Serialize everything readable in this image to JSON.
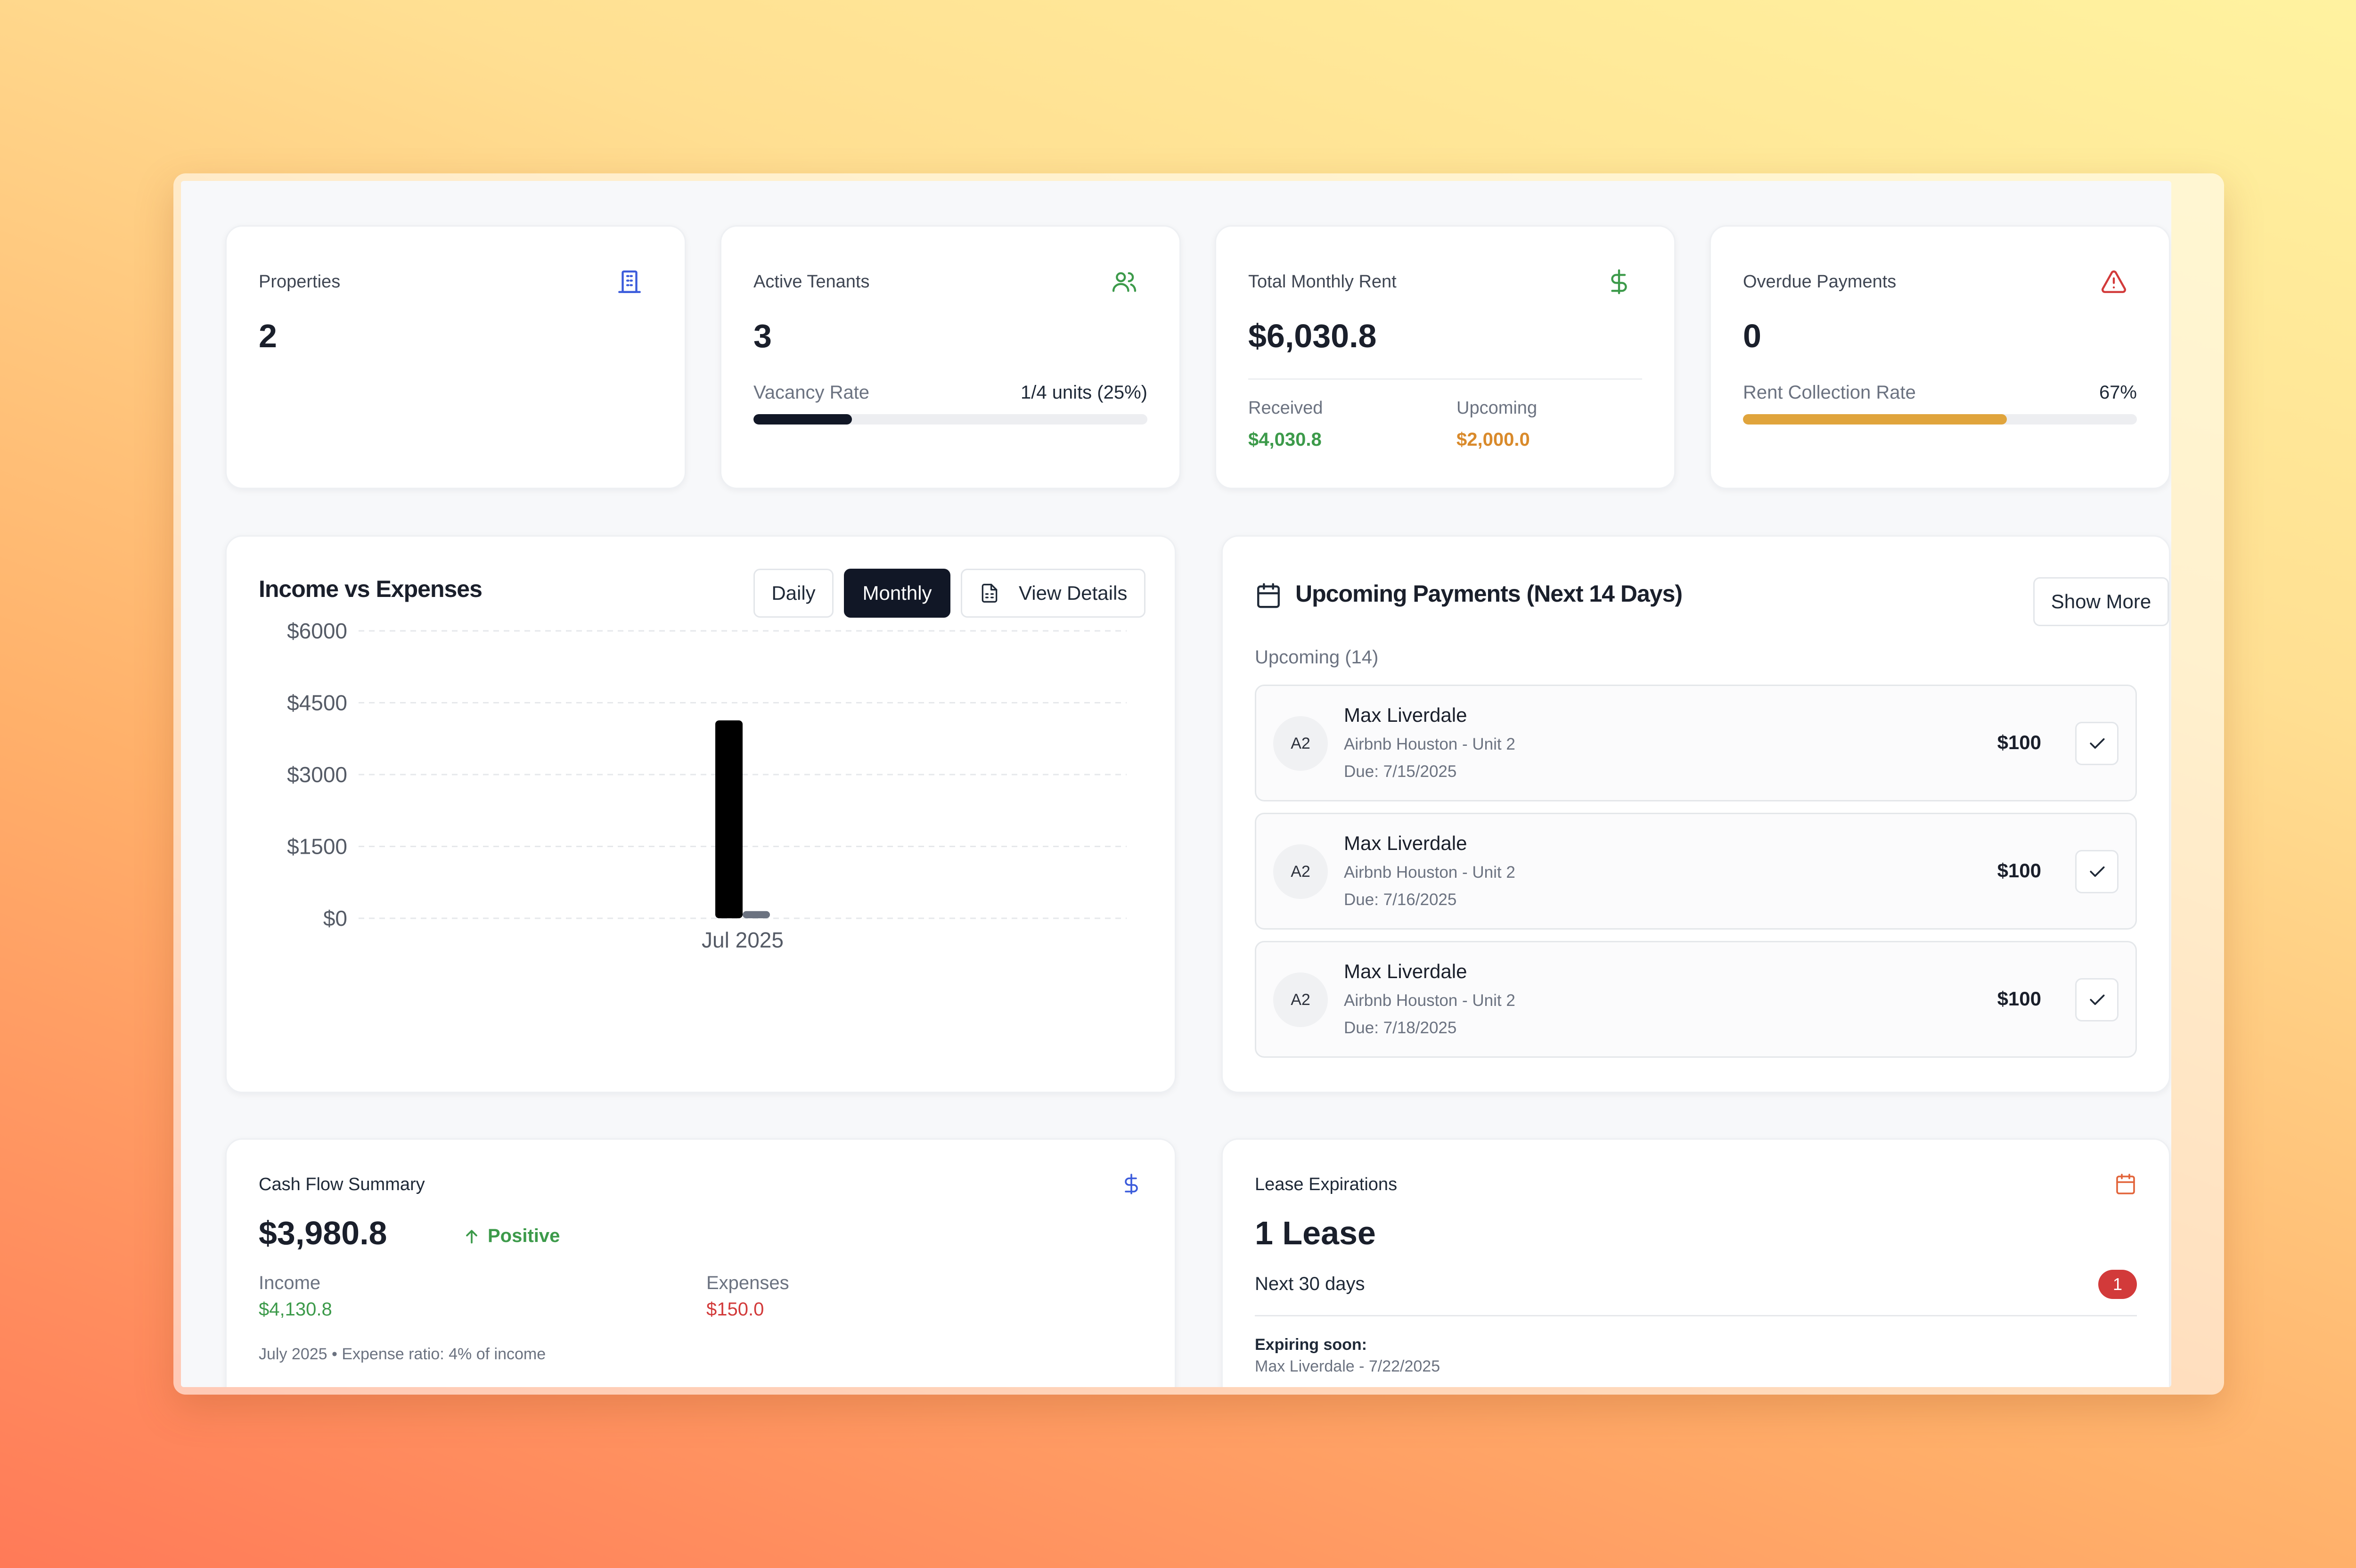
{
  "stats": {
    "properties": {
      "label": "Properties",
      "value": "2",
      "icon": "building-icon"
    },
    "tenants": {
      "label": "Active Tenants",
      "value": "3",
      "icon": "users-icon",
      "vacancy_label": "Vacancy Rate",
      "vacancy_value": "1/4 units (25%)",
      "vacancy_fraction": 0.25
    },
    "rent": {
      "label": "Total Monthly Rent",
      "value": "$6,030.8",
      "icon": "dollar-icon",
      "received_label": "Received",
      "received_value": "$4,030.8",
      "upcoming_label": "Upcoming",
      "upcoming_value": "$2,000.0"
    },
    "overdue": {
      "label": "Overdue Payments",
      "value": "0",
      "icon": "alert-triangle-icon",
      "collection_label": "Rent Collection Rate",
      "collection_value": "67%",
      "collection_fraction": 0.67
    }
  },
  "income_chart": {
    "title": "Income vs Expenses",
    "daily_label": "Daily",
    "monthly_label": "Monthly",
    "details_label": "View Details"
  },
  "chart_data": {
    "type": "bar",
    "categories": [
      "Jul 2025"
    ],
    "series": [
      {
        "values": [
          4130.8
        ],
        "color": "#000000"
      },
      {
        "values": [
          150.0
        ],
        "color": "#6b7280"
      }
    ],
    "y_ticks": [
      "$6000",
      "$4500",
      "$3000",
      "$1500",
      "$0"
    ],
    "y_tick_values": [
      6000,
      4500,
      3000,
      1500,
      0
    ],
    "ylim": [
      0,
      6000
    ],
    "grid": true
  },
  "upcoming": {
    "title": "Upcoming Payments (Next 14 Days)",
    "show_more_label": "Show More",
    "section_label": "Upcoming (14)",
    "items": [
      {
        "initials": "A2",
        "name": "Max Liverdale",
        "property": "Airbnb Houston - Unit 2",
        "due": "Due: 7/15/2025",
        "amount": "$100"
      },
      {
        "initials": "A2",
        "name": "Max Liverdale",
        "property": "Airbnb Houston - Unit 2",
        "due": "Due: 7/16/2025",
        "amount": "$100"
      },
      {
        "initials": "A2",
        "name": "Max Liverdale",
        "property": "Airbnb Houston - Unit 2",
        "due": "Due: 7/18/2025",
        "amount": "$100"
      }
    ]
  },
  "cashflow": {
    "label": "Cash Flow Summary",
    "value": "$3,980.8",
    "trend_label": "Positive",
    "income_label": "Income",
    "income_value": "$4,130.8",
    "expenses_label": "Expenses",
    "expenses_value": "$150.0",
    "footer": "July 2025 • Expense ratio: 4% of income"
  },
  "lease": {
    "label": "Lease Expirations",
    "value": "1 Lease",
    "period_label": "Next 30 days",
    "badge": "1",
    "expiring_label": "Expiring soon:",
    "expiring_detail": "Max Liverdale - 7/22/2025"
  },
  "colors": {
    "accent_dark": "#111726",
    "positive": "#3c9a4a",
    "warning": "#d98a2b",
    "danger": "#d23a3a",
    "collection_bar": "#e0a43c",
    "vacancy_bar": "#111726"
  }
}
